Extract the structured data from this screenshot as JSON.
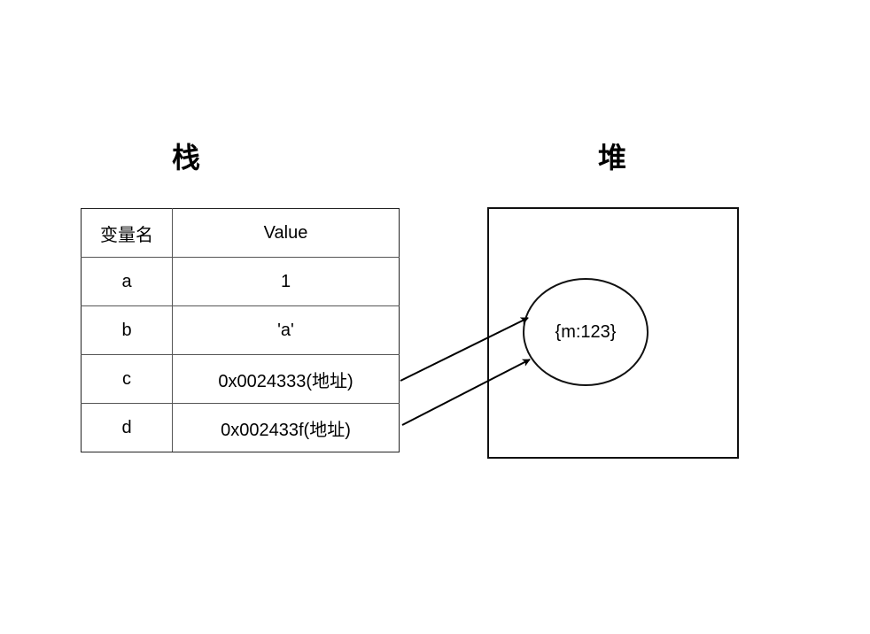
{
  "stack": {
    "title": "栈",
    "header": {
      "name": "变量名",
      "value": "Value"
    },
    "rows": [
      {
        "name": "a",
        "value": "1"
      },
      {
        "name": "b",
        "value": "'a'"
      },
      {
        "name": "c",
        "value": "0x0024333(地址)"
      },
      {
        "name": "d",
        "value": "0x002433f(地址)"
      }
    ]
  },
  "heap": {
    "title": "堆",
    "object_label": "{m:123}"
  }
}
